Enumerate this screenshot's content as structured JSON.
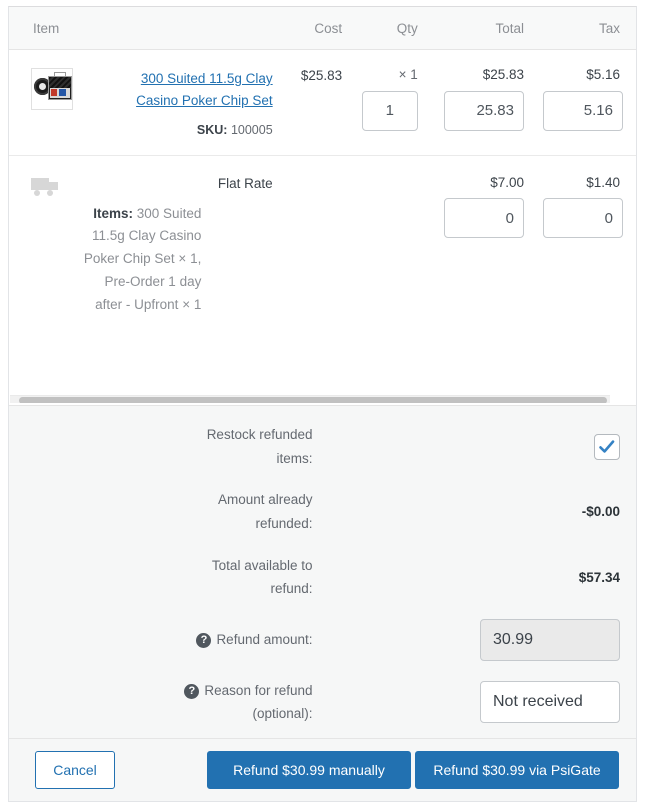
{
  "table": {
    "headers": {
      "item": "Item",
      "cost": "Cost",
      "qty": "Qty",
      "total": "Total",
      "tax": "Tax"
    },
    "line_items": [
      {
        "name": "300 Suited 11.5g Clay Casino Poker Chip Set",
        "sku_label": "SKU:",
        "sku_value": "100005",
        "cost": "$25.83",
        "qty_display": "× 1",
        "qty_input": "1",
        "total": "$25.83",
        "total_input": "25.83",
        "tax": "$5.16",
        "tax_input": "5.16",
        "thumbnail_icon": "poker-chip-case-thumbnail"
      }
    ],
    "shipping_rows": [
      {
        "icon": "truck-icon",
        "method": "Flat Rate",
        "items_label": "Items:",
        "items_value": "300 Suited 11.5g Clay Casino Poker Chip Set × 1, Pre-Order 1 day after - Upfront × 1",
        "total": "$7.00",
        "total_input": "0",
        "tax": "$1.40",
        "tax_input": "0"
      }
    ]
  },
  "summary": {
    "restock_label": "Restock refunded items:",
    "restock_checked": true,
    "already_refunded_label": "Amount already refunded:",
    "already_refunded_value": "-$0.00",
    "total_available_label": "Total available to refund:",
    "total_available_value": "$57.34",
    "refund_amount_label": "Refund amount:",
    "refund_amount_value": "30.99",
    "refund_reason_label": "Reason for refund (optional):",
    "refund_reason_value": "Not received",
    "help_glyph": "?"
  },
  "footer": {
    "cancel_label": "Cancel",
    "refund_manually_label": "Refund $30.99 manually",
    "refund_gateway_label": "Refund $30.99 via PsiGate"
  },
  "colors": {
    "accent": "#2271b1",
    "panel_bg": "#f6f7f7",
    "text": "#50575e",
    "muted": "#8c8f94"
  }
}
